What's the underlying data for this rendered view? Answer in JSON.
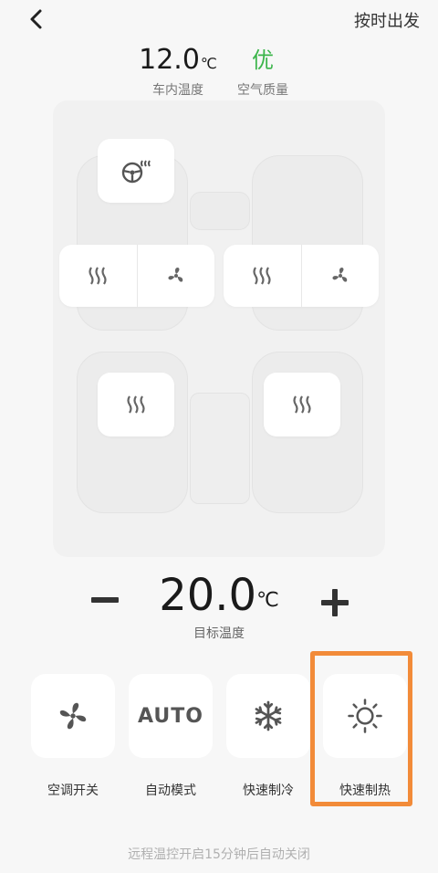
{
  "header": {
    "back_icon": "chevron-left-icon",
    "depart_label": "按时出发"
  },
  "status": {
    "cabin_temp_value": "12.0",
    "cabin_temp_unit": "℃",
    "cabin_temp_label": "车内温度",
    "air_quality_value": "优",
    "air_quality_label": "空气质量",
    "air_quality_color": "#3bb54a"
  },
  "seats": {
    "steering_heat_icon": "steering-wheel-heat-icon",
    "front_left": {
      "heat_icon": "seat-heat-icon",
      "vent_icon": "fan-icon"
    },
    "front_right": {
      "heat_icon": "seat-heat-icon",
      "vent_icon": "fan-icon"
    },
    "rear_left": {
      "heat_icon": "seat-heat-icon"
    },
    "rear_right": {
      "heat_icon": "seat-heat-icon"
    }
  },
  "temperature": {
    "value": "20.0",
    "unit": "℃",
    "label": "目标温度"
  },
  "modes": [
    {
      "label": "空调开关",
      "icon": "fan-icon"
    },
    {
      "label": "自动模式",
      "icon": "auto-text",
      "text": "AUTO"
    },
    {
      "label": "快速制冷",
      "icon": "snowflake-icon"
    },
    {
      "label": "快速制热",
      "icon": "sun-icon"
    }
  ],
  "highlight_color": "#f28b39",
  "footer": {
    "note": "远程温控开启15分钟后自动关闭"
  }
}
